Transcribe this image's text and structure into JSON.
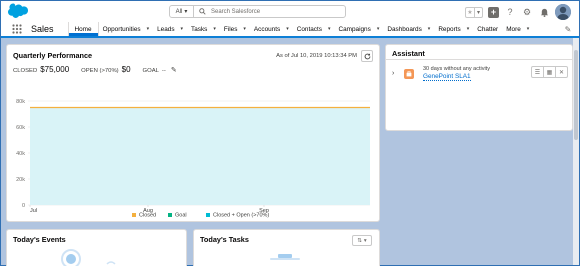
{
  "header": {
    "search": {
      "scope": "All",
      "placeholder": "Search Salesforce"
    },
    "icons": [
      "salesforce-logo",
      "favorites-star-icon",
      "chevron-down-icon",
      "global-actions-icon",
      "help-icon",
      "setup-gear-icon",
      "notification-bell-icon",
      "avatar"
    ]
  },
  "nav": {
    "app_name": "Sales",
    "items": [
      {
        "label": "Home",
        "dropdown": false,
        "active": true
      },
      {
        "label": "Opportunities",
        "dropdown": true
      },
      {
        "label": "Leads",
        "dropdown": true
      },
      {
        "label": "Tasks",
        "dropdown": true
      },
      {
        "label": "Files",
        "dropdown": true
      },
      {
        "label": "Accounts",
        "dropdown": true
      },
      {
        "label": "Contacts",
        "dropdown": true
      },
      {
        "label": "Campaigns",
        "dropdown": true
      },
      {
        "label": "Dashboards",
        "dropdown": true
      },
      {
        "label": "Reports",
        "dropdown": true
      },
      {
        "label": "Chatter",
        "dropdown": false
      },
      {
        "label": "More",
        "dropdown": true
      }
    ]
  },
  "performance": {
    "title": "Quarterly Performance",
    "as_of": "As of Jul 10, 2019 10:13:34 PM",
    "closed_label": "CLOSED",
    "closed_value": "$75,000",
    "open_label": "OPEN (>70%)",
    "open_value": "$0",
    "goal_label": "GOAL",
    "goal_value": "--"
  },
  "chart_data": {
    "type": "area",
    "categories": [
      "Jul",
      "Aug",
      "Sep"
    ],
    "yticks": [
      "0",
      "20k",
      "40k",
      "60k",
      "80k"
    ],
    "ylim": [
      0,
      80000
    ],
    "series": [
      {
        "name": "Closed",
        "color": "#f4b03e",
        "values": [
          75000,
          75000,
          75000
        ]
      },
      {
        "name": "Goal",
        "color": "#04b383",
        "values": []
      },
      {
        "name": "Closed + Open (>70%)",
        "color": "#00bcd4",
        "values": [
          75000,
          75000,
          75000
        ]
      }
    ],
    "grid": true,
    "legend": "bottom"
  },
  "assistant": {
    "title": "Assistant",
    "item_text": "30 days without any activity",
    "item_link": "GenePoint SLA1"
  },
  "events": {
    "title": "Today's Events"
  },
  "tasks": {
    "title": "Today's Tasks"
  }
}
